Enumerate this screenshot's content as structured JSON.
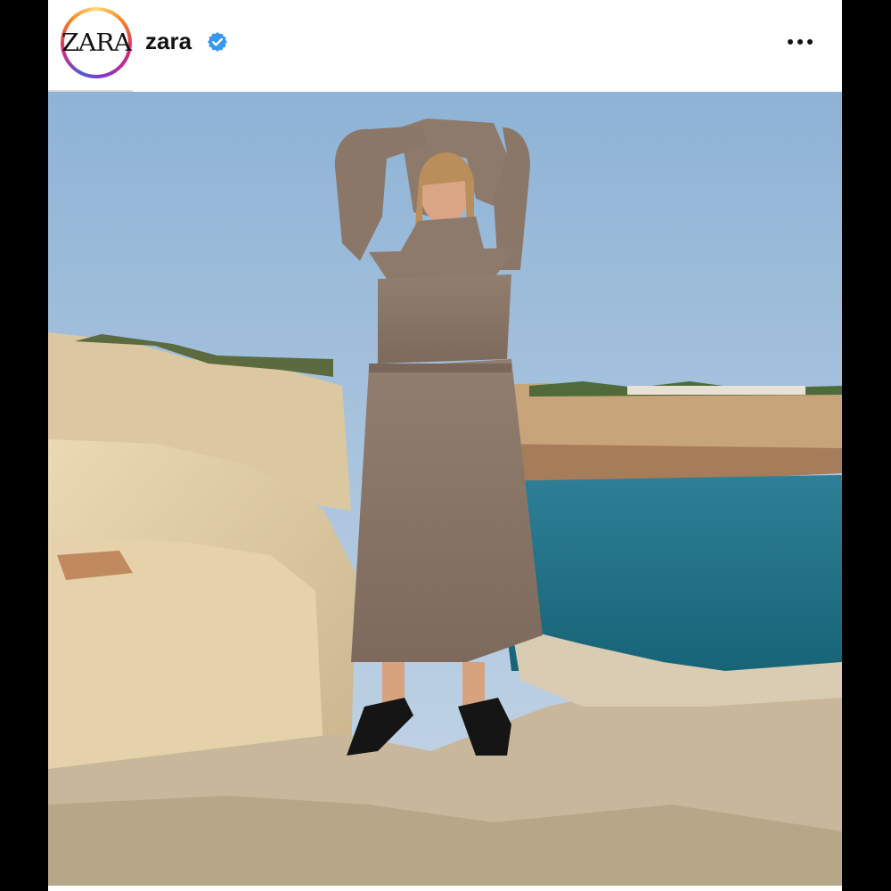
{
  "post": {
    "account": {
      "avatar_text": "ZARA",
      "username": "zara",
      "verified": true,
      "verified_icon": "verified-badge-icon",
      "more_icon": "more-options-icon"
    },
    "image": {
      "description_icon": "post-photo",
      "colors": {
        "sky_top": "#8eb3d6",
        "sea": "#1f7388",
        "rock": "#d8c7a2",
        "dress": "#8b7767",
        "shoes": "#151515"
      }
    }
  }
}
